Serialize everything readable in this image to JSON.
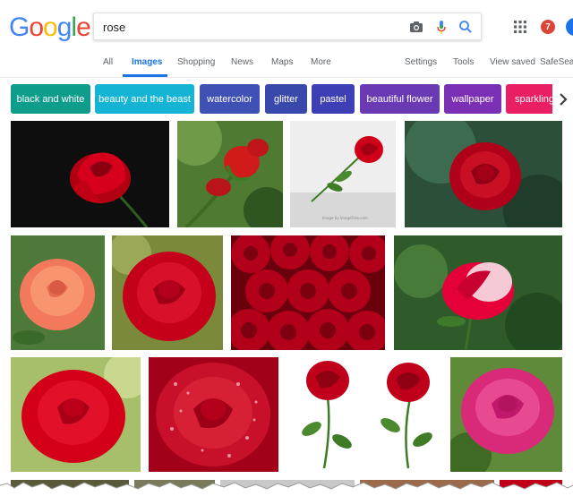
{
  "logo": {
    "letters": [
      "G",
      "o",
      "o",
      "g",
      "l",
      "e"
    ],
    "colors": [
      "#4285f4",
      "#ea4335",
      "#fbbc05",
      "#4285f4",
      "#34a853",
      "#ea4335"
    ]
  },
  "search": {
    "value": "rose"
  },
  "header": {
    "notification_count": "7"
  },
  "tabs": {
    "all": "All",
    "images": "Images",
    "shopping": "Shopping",
    "news": "News",
    "maps": "Maps",
    "more": "More",
    "settings": "Settings",
    "tools": "Tools",
    "view_saved": "View saved",
    "safesearch": "SafeSearch"
  },
  "chips": [
    {
      "label": "black and white",
      "color": "#0f9d8b"
    },
    {
      "label": "beauty and the beast",
      "color": "#16b4d4"
    },
    {
      "label": "watercolor",
      "color": "#3f51b5"
    },
    {
      "label": "glitter",
      "color": "#3949ab"
    },
    {
      "label": "pastel",
      "color": "#3f3fb5"
    },
    {
      "label": "beautiful flower",
      "color": "#6a3ab5"
    },
    {
      "label": "wallpaper",
      "color": "#7b2fb5"
    },
    {
      "label": "sparkling",
      "color": "#e91e63"
    }
  ],
  "images": {
    "watermark_3": "Image by ImageFree.com"
  }
}
